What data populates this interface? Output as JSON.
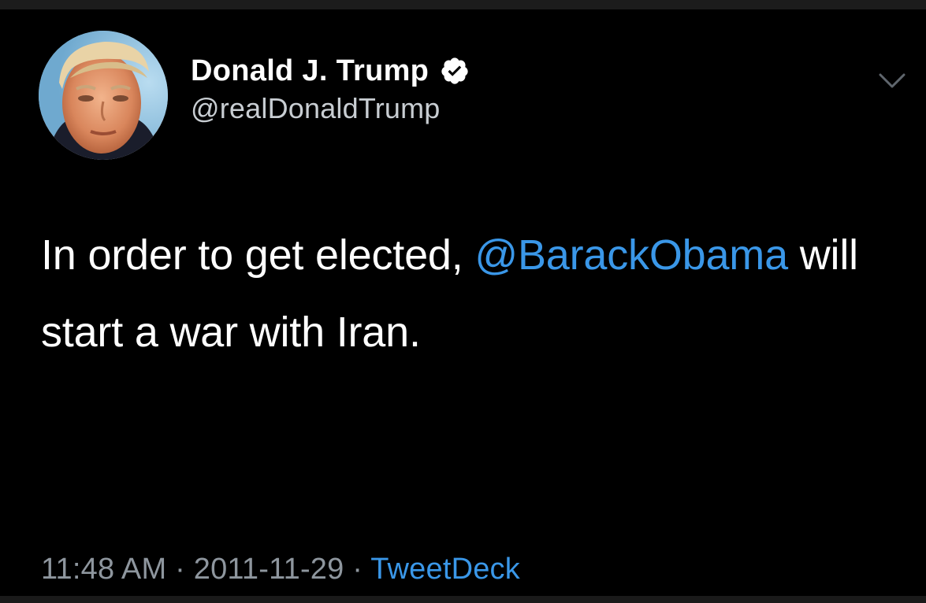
{
  "tweet": {
    "author": {
      "display_name": "Donald J. Trump",
      "handle": "@realDonaldTrump",
      "verified": true,
      "avatar_icon": "profile-photo"
    },
    "text": {
      "before_mention": "In order to get elected, ",
      "mention": "@BarackObama",
      "after_mention": " will start a war with Iran."
    },
    "meta": {
      "time": "11:48 AM",
      "separator": "·",
      "date": "2011-11-29",
      "source": "TweetDeck"
    },
    "menu_icon": "chevron-down-icon"
  },
  "colors": {
    "background": "#000000",
    "link": "#3a97e8",
    "secondary_text": "#8e969e",
    "handle_text": "#c8cdd2",
    "verified_badge": "#ffffff"
  }
}
